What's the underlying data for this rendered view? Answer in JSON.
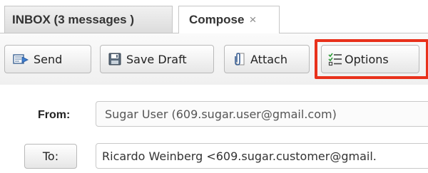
{
  "tabs": {
    "inbox_label": "INBOX (3 messages )",
    "compose_label": "Compose",
    "compose_close": "×"
  },
  "toolbar": {
    "send_label": "Send",
    "save_draft_label": "Save Draft",
    "attach_label": "Attach",
    "options_label": "Options",
    "options_highlight_color": "#e8311b"
  },
  "icons": {
    "send": "send-icon",
    "save_draft": "floppy-disk-icon",
    "attach": "paperclip-icon",
    "options": "checklist-options-icon"
  },
  "form": {
    "from_label": "From:",
    "from_value": "Sugar User (609.sugar.user@gmail.com)",
    "to_button_label": "To:",
    "to_value": "Ricardo Weinberg <609.sugar.customer@gmail."
  }
}
